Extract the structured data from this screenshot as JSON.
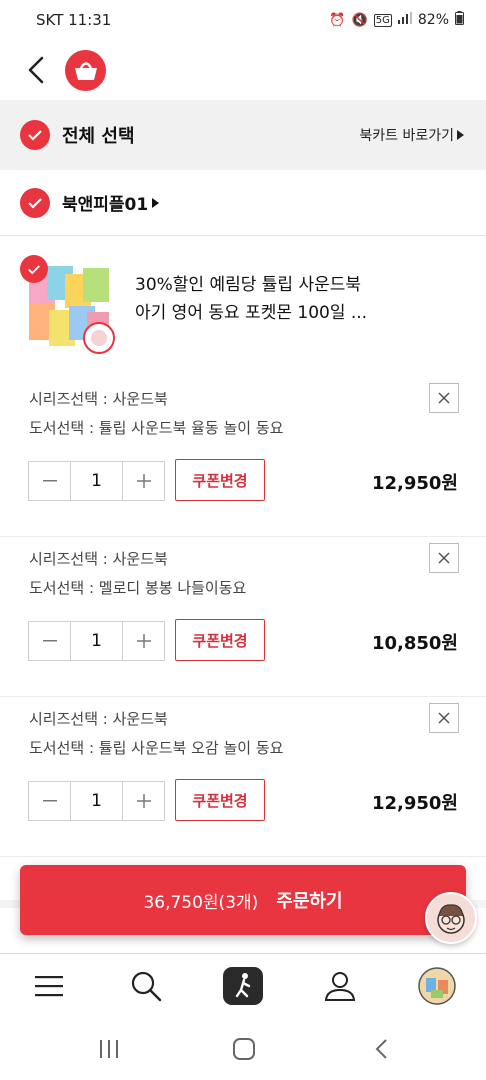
{
  "status_bar": {
    "carrier_time": "SKT 11:31",
    "network": "5G",
    "battery": "82%",
    "icons": [
      "alarm-icon",
      "mute-icon",
      "signal-icon",
      "battery-icon"
    ]
  },
  "header": {
    "back_icon": "chevron-left-icon",
    "logo_icon": "shopping-basket-icon"
  },
  "select_all": {
    "label": "전체 선택",
    "checked": true,
    "bookcart_link": "북카트 바로가기"
  },
  "seller": {
    "name": "북앤피플01",
    "checked": true
  },
  "product": {
    "title_line1": "30%할인 예림당 튤립 사운드북",
    "title_line2": "아기 영어 동요 포켓몬 100일 ...",
    "checked": true
  },
  "options": [
    {
      "series": "시리즈선택 : 사운드북",
      "book": "도서선택 : 튤립 사운드북 율동 놀이 동요",
      "quantity": "1",
      "coupon_label": "쿠폰변경",
      "price": "12,950원"
    },
    {
      "series": "시리즈선택 : 사운드북",
      "book": "도서선택 : 멜로디 봉봉 나들이동요",
      "quantity": "1",
      "coupon_label": "쿠폰변경",
      "price": "10,850원"
    },
    {
      "series": "시리즈선택 : 사운드북",
      "book": "도서선택 : 튤립 사운드북 오감 놀이 동요",
      "quantity": "1",
      "coupon_label": "쿠폰변경",
      "price": "12,950원"
    }
  ],
  "order": {
    "total": "36,750원(3개)",
    "cta": "주문하기"
  },
  "colors": {
    "accent": "#e8353f",
    "coupon": "#d3323b",
    "select_bar_bg": "#f1f1f1"
  },
  "bottom_nav": [
    "menu-icon",
    "search-icon",
    "walk-icon",
    "profile-icon",
    "avatar"
  ],
  "system_nav": [
    "recents-icon",
    "home-icon",
    "back-icon"
  ]
}
